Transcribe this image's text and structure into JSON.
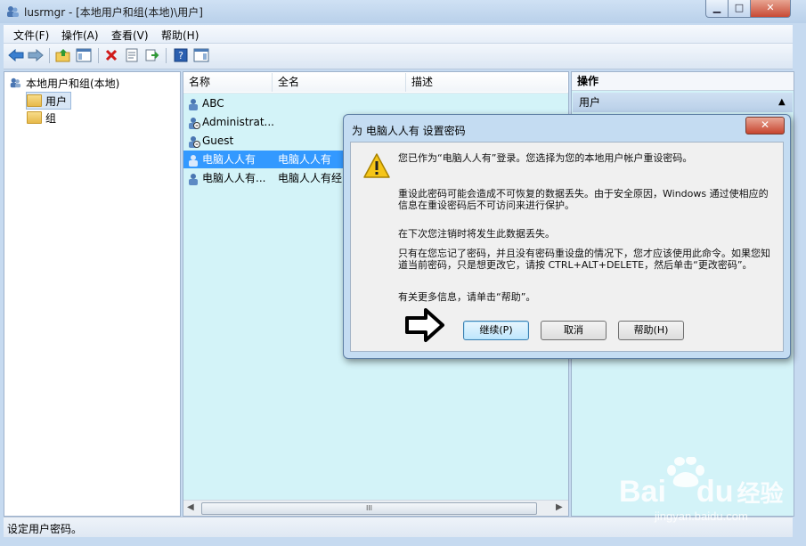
{
  "window": {
    "title": "lusrmgr - [本地用户和组(本地)\\用户]"
  },
  "menubar": {
    "items": [
      "文件(F)",
      "操作(A)",
      "查看(V)",
      "帮助(H)"
    ]
  },
  "toolbar": {
    "icons": [
      "back-arrow-icon",
      "forward-arrow-icon",
      "up-folder-icon",
      "show-hide-tree-icon",
      "delete-icon",
      "properties-icon",
      "export-list-icon",
      "help-icon",
      "action-pane-icon"
    ]
  },
  "tree": {
    "root": "本地用户和组(本地)",
    "children": [
      "用户",
      "组"
    ]
  },
  "list": {
    "columns": [
      "名称",
      "全名",
      "描述"
    ],
    "rows": [
      {
        "name": "ABC",
        "fullname": ""
      },
      {
        "name": "Administrat...",
        "fullname": ""
      },
      {
        "name": "Guest",
        "fullname": ""
      },
      {
        "name": "电脑人人有",
        "fullname": "电脑人人有"
      },
      {
        "name": "电脑人人有...",
        "fullname": "电脑人人有经"
      }
    ],
    "hscroll_grip": "III"
  },
  "actions": {
    "header": "操作",
    "section": "用户"
  },
  "status": {
    "text": "设定用户密码。"
  },
  "dialog": {
    "title": "为 电脑人人有 设置密码",
    "close_label": "✕",
    "p1": "您已作为“电脑人人有”登录。您选择为您的本地用户帐户重设密码。",
    "p2": "重设此密码可能会造成不可恢复的数据丢失。由于安全原因，Windows 通过使相应的信息在重设密码后不可访问来进行保护。",
    "p3": "在下次您注销时将发生此数据丢失。",
    "p4": "只有在您忘记了密码，并且没有密码重设盘的情况下，您才应该使用此命令。如果您知道当前密码，只是想更改它，请按 CTRL+ALT+DELETE，然后单击“更改密码”。",
    "p5": "有关更多信息，请单击“帮助”。",
    "btn_continue": "继续(P)",
    "btn_cancel": "取消",
    "btn_help": "帮助(H)"
  },
  "watermark": {
    "brand": "Bai",
    "brand2": "du",
    "suffix": "经验",
    "url": "jingyan.baidu.com"
  }
}
